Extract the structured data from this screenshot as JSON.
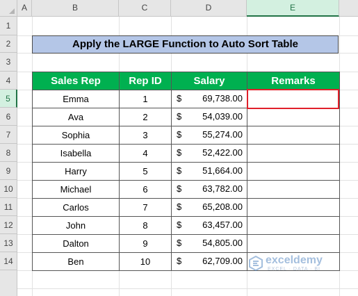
{
  "columns": [
    "A",
    "B",
    "C",
    "D",
    "E"
  ],
  "rows": [
    "1",
    "2",
    "3",
    "4",
    "5",
    "6",
    "7",
    "8",
    "9",
    "10",
    "11",
    "12",
    "13",
    "14"
  ],
  "selected_column": "E",
  "selected_row": "5",
  "title": "Apply the LARGE Function to Auto Sort Table",
  "table": {
    "headers": [
      "Sales Rep",
      "Rep ID",
      "Salary",
      "Remarks"
    ],
    "currency_symbol": "$",
    "records": [
      {
        "name": "Emma",
        "id": "1",
        "salary": "69,738.00",
        "remarks": ""
      },
      {
        "name": "Ava",
        "id": "2",
        "salary": "54,039.00",
        "remarks": ""
      },
      {
        "name": "Sophia",
        "id": "3",
        "salary": "55,274.00",
        "remarks": ""
      },
      {
        "name": "Isabella",
        "id": "4",
        "salary": "52,422.00",
        "remarks": ""
      },
      {
        "name": "Harry",
        "id": "5",
        "salary": "51,664.00",
        "remarks": ""
      },
      {
        "name": "Michael",
        "id": "6",
        "salary": "63,782.00",
        "remarks": ""
      },
      {
        "name": "Carlos",
        "id": "7",
        "salary": "65,208.00",
        "remarks": ""
      },
      {
        "name": "John",
        "id": "8",
        "salary": "63,457.00",
        "remarks": ""
      },
      {
        "name": "Dalton",
        "id": "9",
        "salary": "54,805.00",
        "remarks": ""
      },
      {
        "name": "Ben",
        "id": "10",
        "salary": "62,709.00",
        "remarks": ""
      }
    ]
  },
  "watermark": {
    "brand": "exceldemy",
    "tagline": "EXCEL · DATA · BI",
    "icon": "exceldemy-logo-icon"
  },
  "colors": {
    "header_green": "#00b050",
    "title_blue": "#b4c6e7",
    "selection_red": "#e0202a",
    "excel_green": "#217346"
  }
}
